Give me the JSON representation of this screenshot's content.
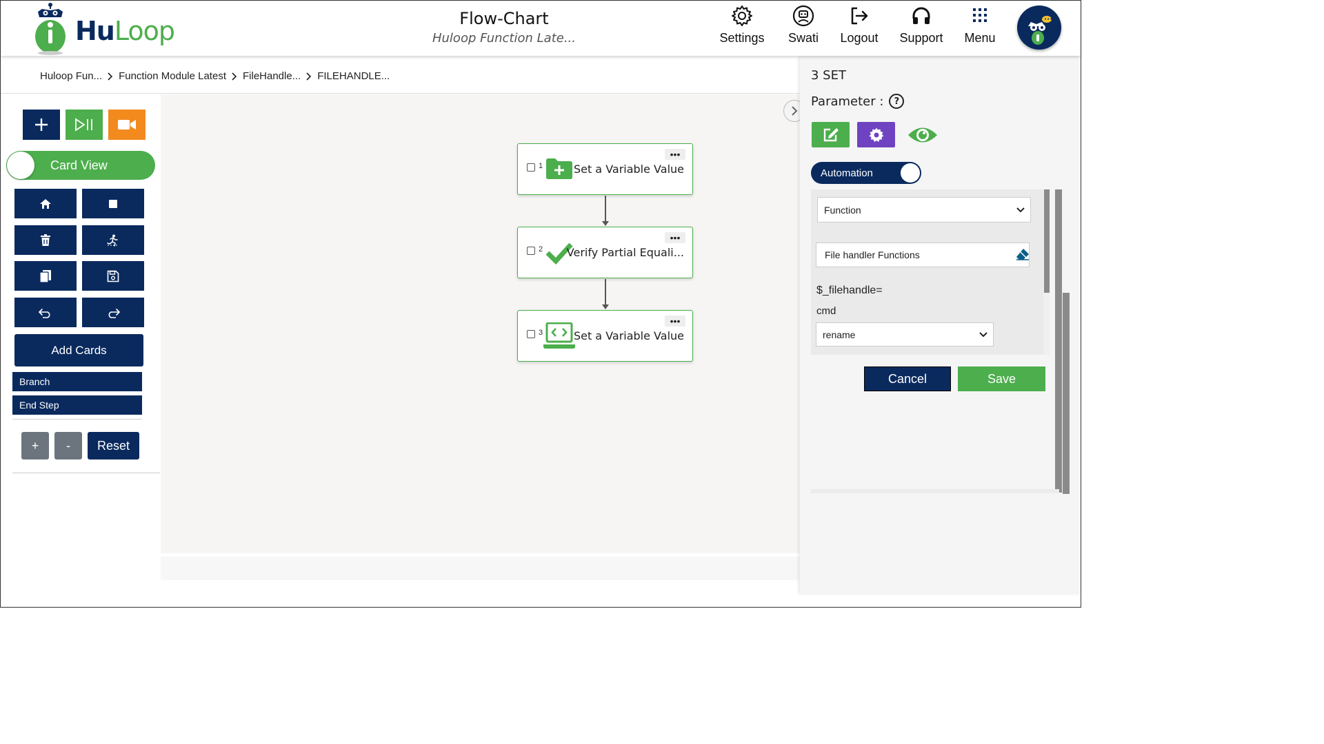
{
  "app": {
    "logo_prefix": "Hu",
    "logo_suffix": "Loop",
    "title": "Flow-Chart",
    "subtitle": "Huloop Function Late..."
  },
  "nav": {
    "settings": "Settings",
    "user": "Swati",
    "logout": "Logout",
    "support": "Support",
    "menu": "Menu"
  },
  "breadcrumb": [
    "Huloop Fun...",
    "Function Module Latest",
    "FileHandle...",
    "FILEHANDLE..."
  ],
  "toolbar": {
    "card_view_label": "Card View",
    "add_cards_label": "Add Cards",
    "branch_label": "Branch",
    "end_step_label": "End Step",
    "zoom_in_label": "+",
    "zoom_out_label": "-",
    "reset_label": "Reset"
  },
  "flow": {
    "cards": [
      {
        "number": "1",
        "label": "Set a Variable Value",
        "icon": "folder-plus-icon"
      },
      {
        "number": "2",
        "label": "Verify Partial Equali...",
        "icon": "check-icon"
      },
      {
        "number": "3",
        "label": "Set a Variable Value",
        "icon": "laptop-code-icon"
      }
    ],
    "menu_dots": "•••"
  },
  "panel": {
    "step_title": "3 SET",
    "parameter_label": "Parameter :",
    "help_glyph": "?",
    "automation_label": "Automation",
    "type_select_value": "Function",
    "function_input_value": "File handler Functions",
    "variable_label": "$_filehandle=",
    "cmd_label": "cmd",
    "cmd_select_value": "rename",
    "cancel_label": "Cancel",
    "save_label": "Save"
  },
  "colors": {
    "navy": "#0a2a5e",
    "green": "#4cae4c",
    "orange": "#f28a1e",
    "purple": "#6f42c1",
    "gray_button": "#6c757d"
  }
}
